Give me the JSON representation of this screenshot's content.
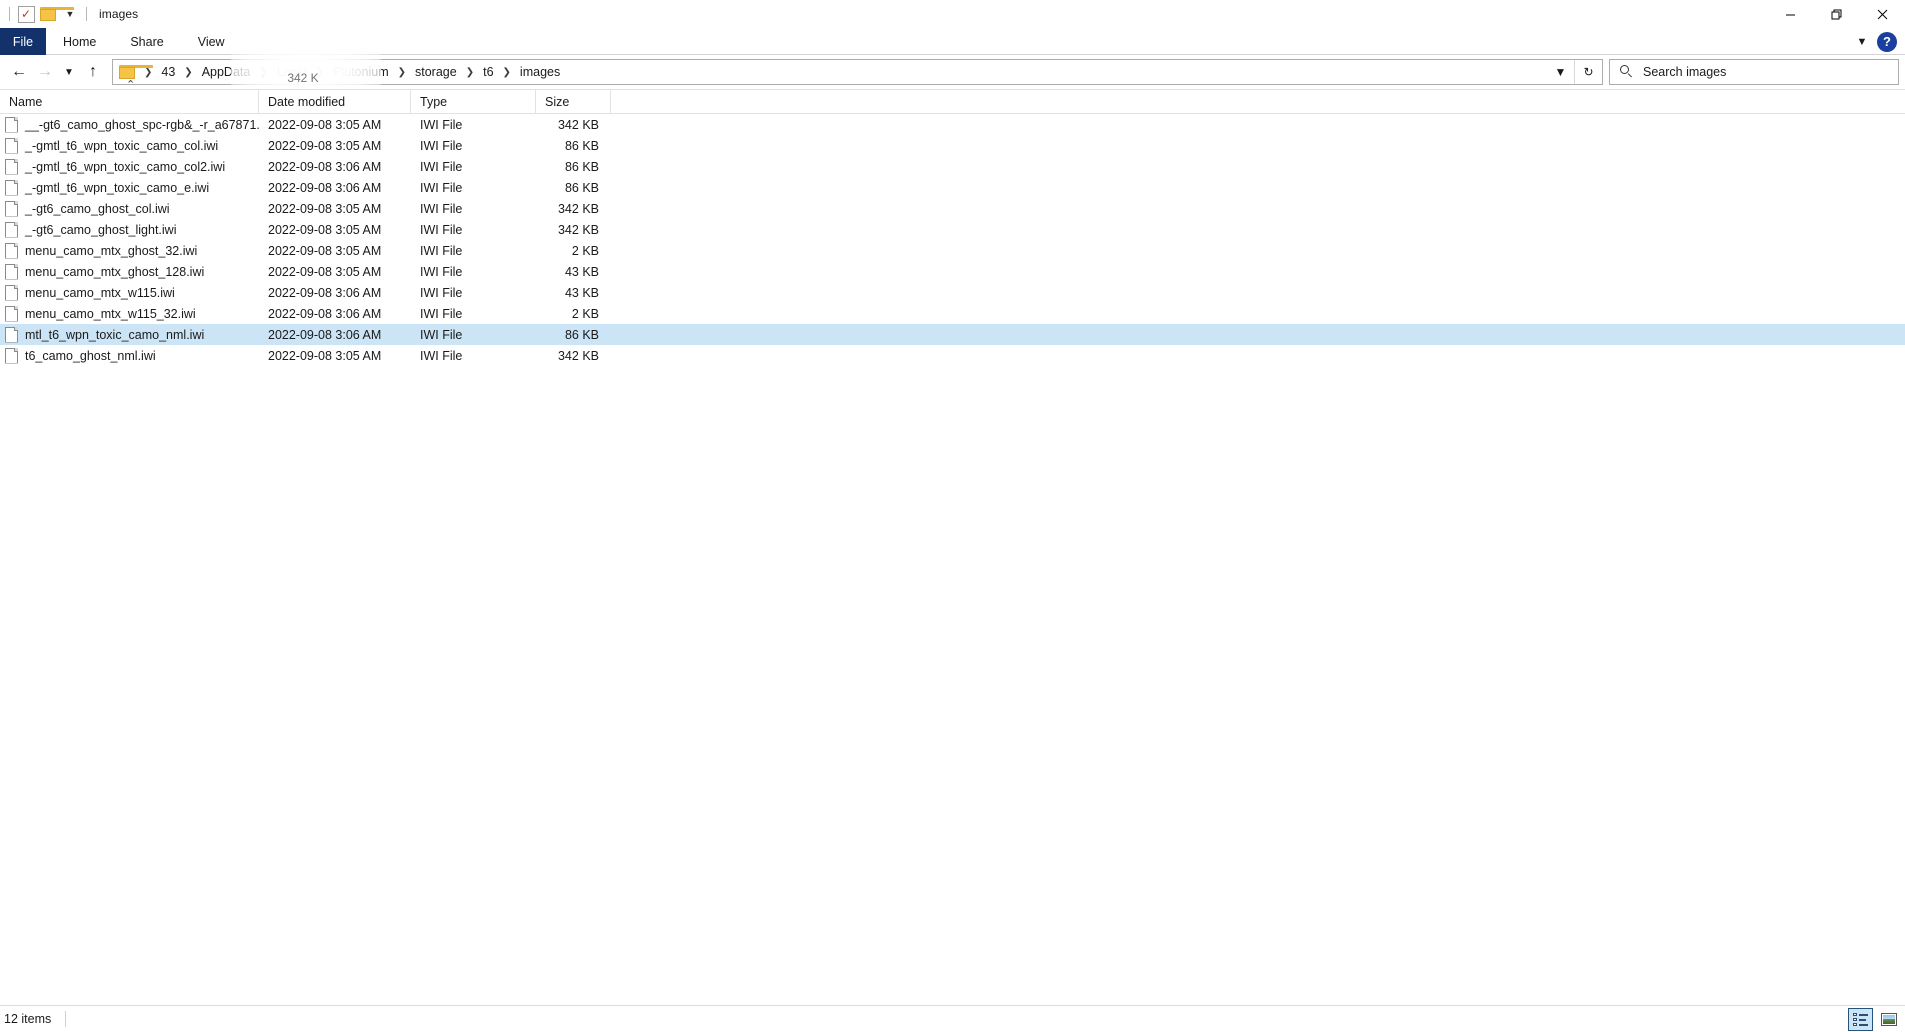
{
  "window": {
    "title": "images",
    "quick_access": {
      "check_icon": "check-icon",
      "folder_icon": "folder-icon",
      "dropdown_icon": "chevron-down-icon"
    },
    "controls": {
      "minimize": "—",
      "restore": "❑",
      "close": "✕"
    },
    "ribbon_collapse_icon": "chevron-down-icon",
    "help_label": "?"
  },
  "ribbon": {
    "tabs": [
      {
        "label": "File",
        "active": true
      },
      {
        "label": "Home",
        "active": false
      },
      {
        "label": "Share",
        "active": false
      },
      {
        "label": "View",
        "active": false
      }
    ]
  },
  "navigation": {
    "back_label": "←",
    "forward_label": "→",
    "recent_label": "⌄",
    "up_label": "↑"
  },
  "address": {
    "folder_icon": "folder-icon",
    "separator": "❯",
    "crumbs": [
      "43",
      "AppData",
      "Local",
      "Plutonium",
      "storage",
      "t6",
      "images"
    ],
    "dropdown_icon": "⌄",
    "refresh_icon": "↻",
    "tooltip_artifact": "342 K"
  },
  "search": {
    "icon": "search-icon",
    "placeholder": "Search images"
  },
  "columns": {
    "headers": [
      "Name",
      "Date modified",
      "Type",
      "Size"
    ],
    "sort_indicator": "⌃",
    "sorted_by": "Name"
  },
  "files": [
    {
      "name": "__-gt6_camo_ghost_spc-rgb&_-r_a67871...",
      "date": "2022-09-08 3:05 AM",
      "type": "IWI File",
      "size": "342 KB",
      "selected": false
    },
    {
      "name": "_-gmtl_t6_wpn_toxic_camo_col.iwi",
      "date": "2022-09-08 3:05 AM",
      "type": "IWI File",
      "size": "86 KB",
      "selected": false
    },
    {
      "name": "_-gmtl_t6_wpn_toxic_camo_col2.iwi",
      "date": "2022-09-08 3:06 AM",
      "type": "IWI File",
      "size": "86 KB",
      "selected": false
    },
    {
      "name": "_-gmtl_t6_wpn_toxic_camo_e.iwi",
      "date": "2022-09-08 3:06 AM",
      "type": "IWI File",
      "size": "86 KB",
      "selected": false
    },
    {
      "name": "_-gt6_camo_ghost_col.iwi",
      "date": "2022-09-08 3:05 AM",
      "type": "IWI File",
      "size": "342 KB",
      "selected": false
    },
    {
      "name": "_-gt6_camo_ghost_light.iwi",
      "date": "2022-09-08 3:05 AM",
      "type": "IWI File",
      "size": "342 KB",
      "selected": false
    },
    {
      "name": "menu_camo_mtx_ghost_32.iwi",
      "date": "2022-09-08 3:05 AM",
      "type": "IWI File",
      "size": "2 KB",
      "selected": false
    },
    {
      "name": "menu_camo_mtx_ghost_128.iwi",
      "date": "2022-09-08 3:05 AM",
      "type": "IWI File",
      "size": "43 KB",
      "selected": false
    },
    {
      "name": "menu_camo_mtx_w115.iwi",
      "date": "2022-09-08 3:06 AM",
      "type": "IWI File",
      "size": "43 KB",
      "selected": false
    },
    {
      "name": "menu_camo_mtx_w115_32.iwi",
      "date": "2022-09-08 3:06 AM",
      "type": "IWI File",
      "size": "2 KB",
      "selected": false
    },
    {
      "name": "mtl_t6_wpn_toxic_camo_nml.iwi",
      "date": "2022-09-08 3:06 AM",
      "type": "IWI File",
      "size": "86 KB",
      "selected": true
    },
    {
      "name": "t6_camo_ghost_nml.iwi",
      "date": "2022-09-08 3:05 AM",
      "type": "IWI File",
      "size": "342 KB",
      "selected": false
    }
  ],
  "status": {
    "item_count": "12 items",
    "details_view_icon": "details-view-icon",
    "tiles_view_icon": "large-icons-view-icon"
  },
  "colors": {
    "file_tab": "#13326b",
    "selection": "#cce5f6",
    "help": "#1b3f9e",
    "folder": "#f6c444"
  }
}
